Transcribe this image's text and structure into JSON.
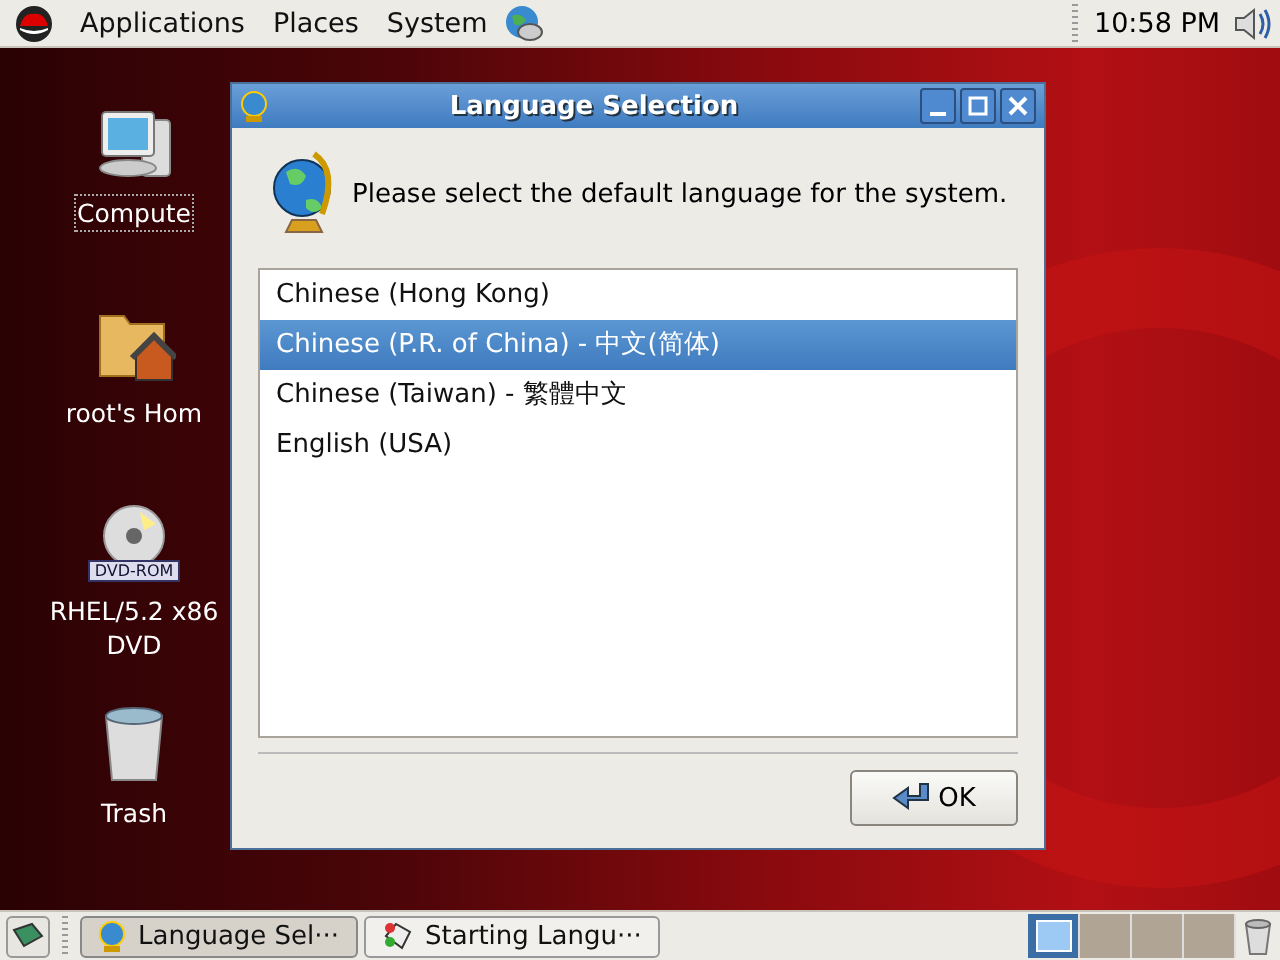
{
  "top_panel": {
    "menus": [
      "Applications",
      "Places",
      "System"
    ],
    "clock": "10:58 PM"
  },
  "desktop_icons": [
    {
      "kind": "computer",
      "label": "Compute"
    },
    {
      "kind": "home",
      "label": "root's Hom"
    },
    {
      "kind": "dvd",
      "label": "RHEL/5.2 x86\nDVD",
      "badge": "DVD-ROM"
    },
    {
      "kind": "trash",
      "label": "Trash"
    }
  ],
  "dialog": {
    "title": "Language Selection",
    "prompt": "Please select the default language for the system.",
    "languages": [
      {
        "label": "Chinese (Hong Kong)",
        "selected": false
      },
      {
        "label": "Chinese (P.R. of China) - 中文(简体)",
        "selected": true
      },
      {
        "label": "Chinese (Taiwan) - 繁體中文",
        "selected": false
      },
      {
        "label": "English (USA)",
        "selected": false
      }
    ],
    "ok_button": "OK"
  },
  "taskbar": {
    "windows": [
      {
        "label": "Language Sel···",
        "kind": "globe",
        "selected": true
      },
      {
        "label": "Starting Langu···",
        "kind": "launch",
        "selected": false
      }
    ],
    "workspaces": [
      {
        "selected": true
      },
      {
        "selected": false
      },
      {
        "selected": false
      },
      {
        "selected": false
      }
    ]
  }
}
